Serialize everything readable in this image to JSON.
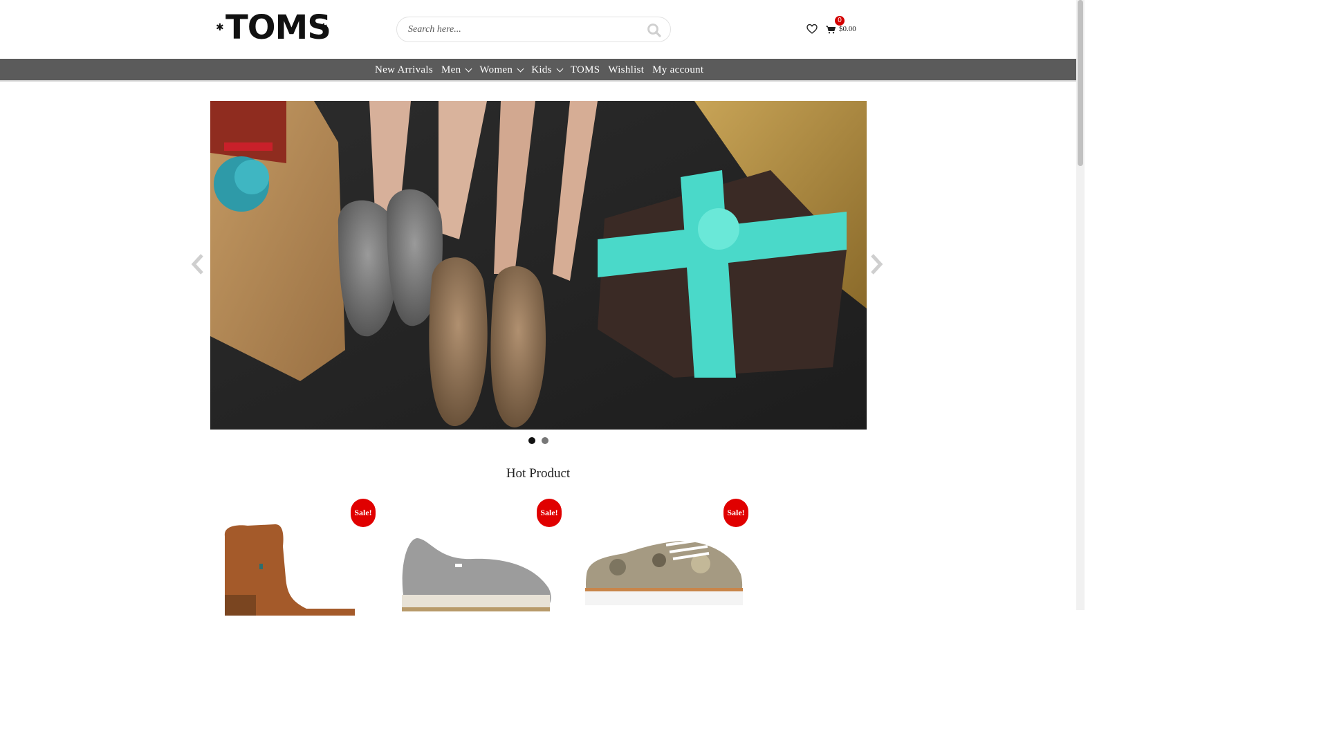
{
  "header": {
    "logo_text": "TOMS",
    "search_placeholder": "Search here...",
    "cart_count": "0",
    "cart_total": "$0.00"
  },
  "nav": {
    "items": [
      {
        "label": "New Arrivals",
        "has_dropdown": false
      },
      {
        "label": "Men",
        "has_dropdown": true
      },
      {
        "label": "Women",
        "has_dropdown": true
      },
      {
        "label": "Kids",
        "has_dropdown": true
      },
      {
        "label": "TOMS",
        "has_dropdown": false
      },
      {
        "label": "Wishlist",
        "has_dropdown": false
      },
      {
        "label": "My account",
        "has_dropdown": false
      }
    ]
  },
  "slider": {
    "dots": [
      "1",
      "2"
    ],
    "active_dot": 1
  },
  "hot_products": {
    "title": "Hot Product",
    "items": [
      {
        "badge": "Sale!"
      },
      {
        "badge": "Sale!"
      },
      {
        "badge": "Sale!"
      }
    ]
  },
  "colors": {
    "nav_bg": "#5b5b5b",
    "sale_badge": "#e00000",
    "cart_badge": "#d40000"
  }
}
